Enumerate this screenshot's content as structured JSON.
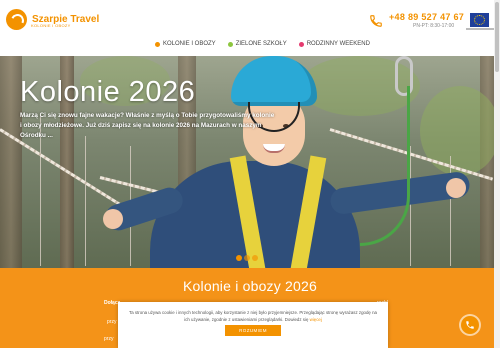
{
  "header": {
    "logo_name": "Szarpie Travel",
    "logo_tagline": "KOLONIE I OBOZY",
    "phone": "+48 89 527 47 67",
    "hours": "PN-PT: 8:30-17:00",
    "phone_icon": "phone-icon",
    "eu_flag_icon": "eu-flag-icon"
  },
  "nav": {
    "items": [
      {
        "label": "KOLONIE I OBOZY",
        "dot_color": "#f39200"
      },
      {
        "label": "ZIELONE SZKOŁY",
        "dot_color": "#8dc63f"
      },
      {
        "label": "RODZINNY WEEKEND",
        "dot_color": "#e53b6f"
      }
    ]
  },
  "hero": {
    "title": "Kolonie 2026",
    "text": "Marzą Ci się znowu fajne wakacje? Właśnie z myślą o Tobie przygotowaliśmy kolonie i obozy młodzieżowe. Już dziś zapisz się na kolonie 2026 na Mazurach w naszym Ośrodku ...",
    "slides": 3,
    "active_slide": 1
  },
  "section": {
    "title": "Kolonie i obozy 2026",
    "lead_bold": "Dołącz",
    "right_fragment": "rach!",
    "left_fragment_1": "przy",
    "left_fragment_2": "przy",
    "right_fragment_2": "motr"
  },
  "cookie": {
    "text": "Ta strona używa cookie i innych technologii, aby korzystanie z niej było przyjemniejsze. Przeglądając stronę wyrażasz zgodę na ich używanie, zgodnie z ustawieniami przeglądarki. Dowiedz się więcej",
    "link_text": "więcej",
    "button_label": "ROZUMIEM"
  },
  "floating": {
    "call_button_icon": "phone-icon"
  },
  "colors": {
    "brand_orange": "#f39200",
    "band_orange": "#f49318",
    "green": "#8dc63f",
    "pink": "#e53b6f"
  }
}
